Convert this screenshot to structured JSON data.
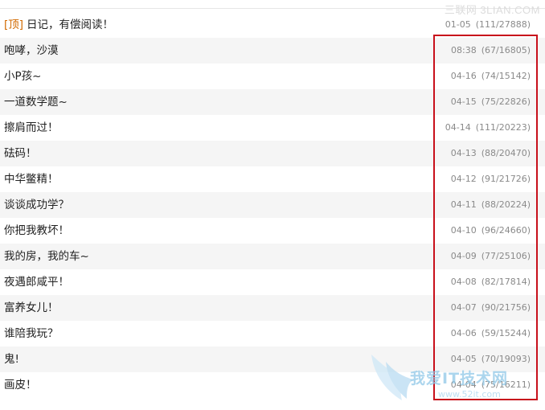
{
  "watermark_top": "三联网 3LIAN.COM",
  "posts": [
    {
      "tag": "[顶]",
      "title": "日记，有偿阅读！",
      "date": "01-05",
      "stats": "(111/27888)"
    },
    {
      "title": "咆哮，沙漠",
      "date": "08:38",
      "stats": "(67/16805)"
    },
    {
      "title": "小P孩~",
      "date": "04-16",
      "stats": "(74/15142)"
    },
    {
      "title": "一道数学题~",
      "date": "04-15",
      "stats": "(75/22826)"
    },
    {
      "title": "擦肩而过！",
      "date": "04-14",
      "stats": "(111/20223)"
    },
    {
      "title": "砝码！",
      "date": "04-13",
      "stats": "(88/20470)"
    },
    {
      "title": "中华鳖精！",
      "date": "04-12",
      "stats": "(91/21726)"
    },
    {
      "title": "谈谈成功学？",
      "date": "04-11",
      "stats": "(88/20224)"
    },
    {
      "title": "你把我教坏！",
      "date": "04-10",
      "stats": "(96/24660)"
    },
    {
      "title": "我的房，我的车~",
      "date": "04-09",
      "stats": "(77/25106)"
    },
    {
      "title": "夜遇郎咸平！",
      "date": "04-08",
      "stats": "(82/17814)"
    },
    {
      "title": "富养女儿！",
      "date": "04-07",
      "stats": "(90/21756)"
    },
    {
      "title": "谁陪我玩？",
      "date": "04-06",
      "stats": "(59/15244)"
    },
    {
      "title": "鬼!",
      "date": "04-05",
      "stats": "(70/19093)"
    },
    {
      "title": "画皮！",
      "date": "04-04",
      "stats": "(75/16211)"
    }
  ],
  "watermark_logo": {
    "brand": "我爱IT技术网",
    "site": "www.52it.com"
  },
  "colors": {
    "highlight_border": "#c8101b",
    "top_tag": "#d26a00",
    "alt_row": "#f5f5f5"
  }
}
